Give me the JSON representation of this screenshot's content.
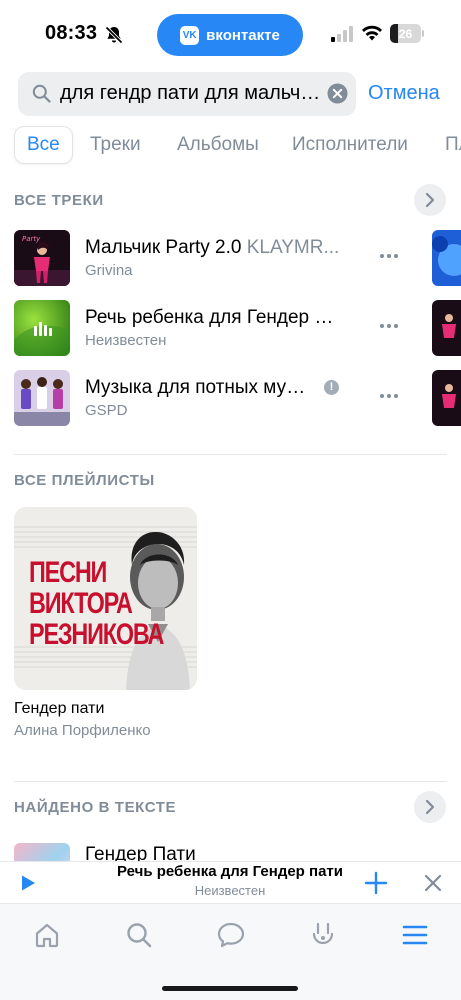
{
  "status_bar": {
    "time": "08:33",
    "app_pill": "вконтакте",
    "battery_level": "26",
    "battery_fraction": 0.26
  },
  "search": {
    "query": "для гендр пати для мальчика",
    "cancel_label": "Отмена"
  },
  "tabs": [
    {
      "label": "Все",
      "active": true
    },
    {
      "label": "Треки",
      "active": false
    },
    {
      "label": "Альбомы",
      "active": false
    },
    {
      "label": "Исполнители",
      "active": false
    },
    {
      "label": "Пл",
      "active": false
    }
  ],
  "tracks_section": {
    "title": "Все треки",
    "tracks": [
      {
        "title": "Мальчик Party 2.0",
        "featuring": "KLAYMR...",
        "artist": "Grivina",
        "explicit": false
      },
      {
        "title": "Речь ребенка для Гендер пати",
        "featuring": "",
        "artist": "Неизвестен",
        "explicit": false
      },
      {
        "title": "Музыка для потных мужиков",
        "featuring": "",
        "artist": "GSPD",
        "explicit": true
      }
    ]
  },
  "playlists_section": {
    "title": "Все плейлисты",
    "playlist": {
      "cover_text": [
        "ПЕСНИ",
        "ВИКТОРА",
        "РЕЗНИКОВА"
      ],
      "name": "Гендер пати",
      "owner": "Алина Порфиленко"
    }
  },
  "lyrics_section": {
    "title": "Найдено в тексте",
    "track_title": "Гендер Пати"
  },
  "mini_player": {
    "title": "Речь ребенка для Гендер пати",
    "artist": "Неизвестен"
  },
  "bottom_nav": [
    {
      "icon": "home-icon"
    },
    {
      "icon": "search-icon"
    },
    {
      "icon": "messages-icon"
    },
    {
      "icon": "clips-icon"
    },
    {
      "icon": "menu-icon",
      "active": true
    }
  ],
  "colors": {
    "accent": "#2787F5",
    "secondary_text": "#818C99",
    "cover_red": "#C8102E"
  }
}
